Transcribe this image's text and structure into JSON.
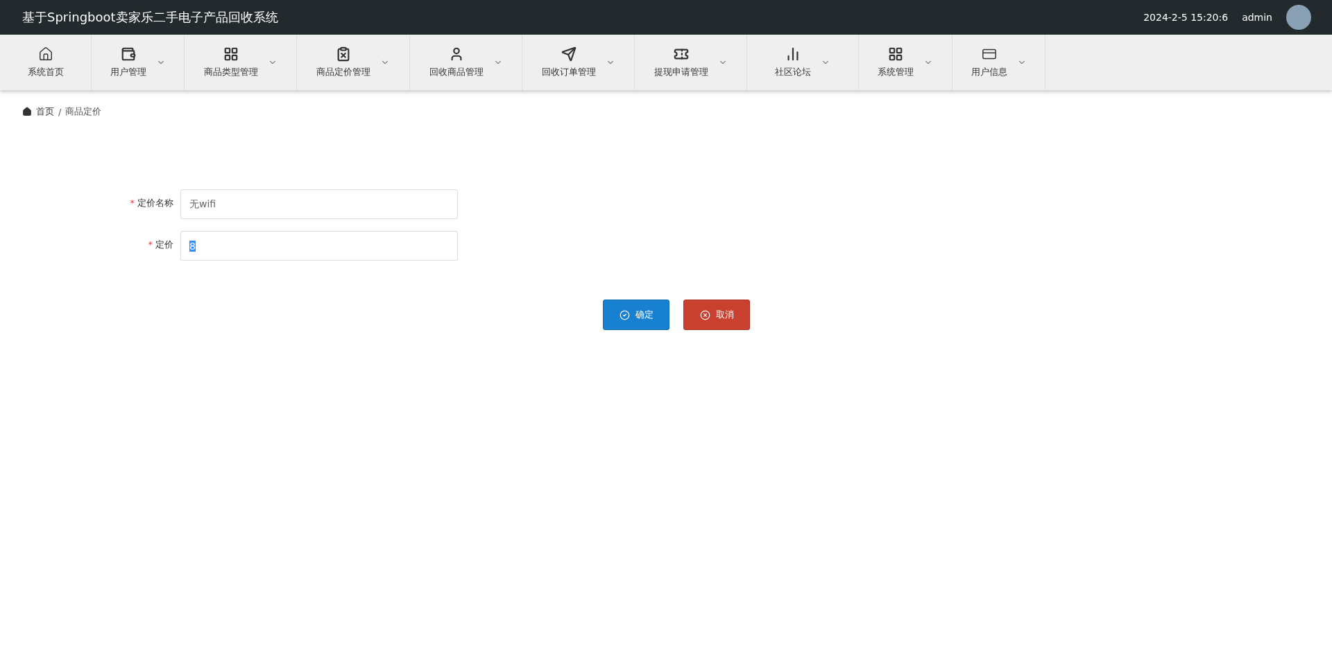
{
  "header": {
    "title": "基于Springboot卖家乐二手电子产品回收系统",
    "datetime": "2024-2-5 15:20:6",
    "username": "admin"
  },
  "nav": [
    {
      "label": "系统首页",
      "has_dropdown": false
    },
    {
      "label": "用户管理",
      "has_dropdown": true
    },
    {
      "label": "商品类型管理",
      "has_dropdown": true
    },
    {
      "label": "商品定价管理",
      "has_dropdown": true
    },
    {
      "label": "回收商品管理",
      "has_dropdown": true
    },
    {
      "label": "回收订单管理",
      "has_dropdown": true
    },
    {
      "label": "提现申请管理",
      "has_dropdown": true
    },
    {
      "label": "社区论坛",
      "has_dropdown": true
    },
    {
      "label": "系统管理",
      "has_dropdown": true
    },
    {
      "label": "用户信息",
      "has_dropdown": true
    }
  ],
  "breadcrumb": {
    "home": "首页",
    "separator": "/",
    "current": "商品定价"
  },
  "form": {
    "fields": [
      {
        "label": "定价名称",
        "required": "*",
        "value": "无wifi",
        "selected": false
      },
      {
        "label": "定价",
        "required": "*",
        "value": "8",
        "selected": true
      }
    ],
    "buttons": [
      {
        "kind": "primary",
        "label": "确定"
      },
      {
        "kind": "danger",
        "label": "取消"
      }
    ]
  }
}
